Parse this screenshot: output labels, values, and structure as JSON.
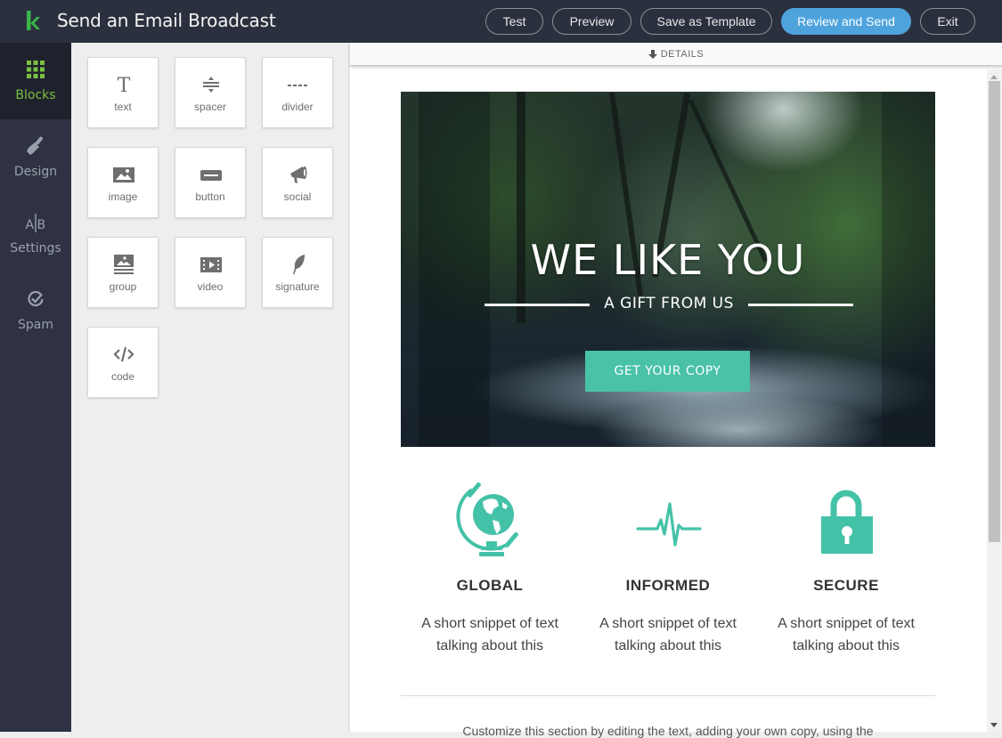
{
  "header": {
    "title": "Send an Email Broadcast",
    "logo_icon": "kit-k-logo-icon",
    "buttons": {
      "test": "Test",
      "preview": "Preview",
      "save_template": "Save as Template",
      "review_send": "Review and Send",
      "exit": "Exit"
    },
    "accent_color": "#4ea3dd"
  },
  "nav": {
    "items": [
      {
        "label": "Blocks",
        "icon": "grid-icon",
        "active": true
      },
      {
        "label": "Design",
        "icon": "paintbrush-icon",
        "active": false
      },
      {
        "label": "Settings",
        "icon": "ab-split-icon",
        "active": false
      },
      {
        "label": "Spam",
        "icon": "check-circle-icon",
        "active": false
      }
    ],
    "active_color": "#7ac142"
  },
  "blocks": {
    "items": [
      {
        "label": "text",
        "icon": "text-t-icon"
      },
      {
        "label": "spacer",
        "icon": "spacer-icon"
      },
      {
        "label": "divider",
        "icon": "divider-dashes-icon"
      },
      {
        "label": "image",
        "icon": "image-icon"
      },
      {
        "label": "button",
        "icon": "button-icon"
      },
      {
        "label": "social",
        "icon": "megaphone-icon"
      },
      {
        "label": "group",
        "icon": "group-icon"
      },
      {
        "label": "video",
        "icon": "film-play-icon"
      },
      {
        "label": "signature",
        "icon": "feather-icon"
      },
      {
        "label": "code",
        "icon": "code-icon"
      }
    ]
  },
  "editor": {
    "details_label": "DETAILS",
    "details_icon": "arrow-down-icon",
    "hero": {
      "title": "WE LIKE YOU",
      "subtitle": "A GIFT FROM US",
      "cta": "GET YOUR COPY",
      "cta_color": "#49c2a8"
    },
    "features": [
      {
        "title": "GLOBAL",
        "text": "A short snippet of text talking about this",
        "icon": "globe-icon"
      },
      {
        "title": "INFORMED",
        "text": "A short snippet of text talking about this",
        "icon": "heartbeat-icon"
      },
      {
        "title": "SECURE",
        "text": "A short snippet of text talking about this",
        "icon": "padlock-icon"
      }
    ],
    "feature_icon_color": "#44c2a8",
    "bottom_text": "Customize this section by editing the text, adding your own copy, using the"
  }
}
